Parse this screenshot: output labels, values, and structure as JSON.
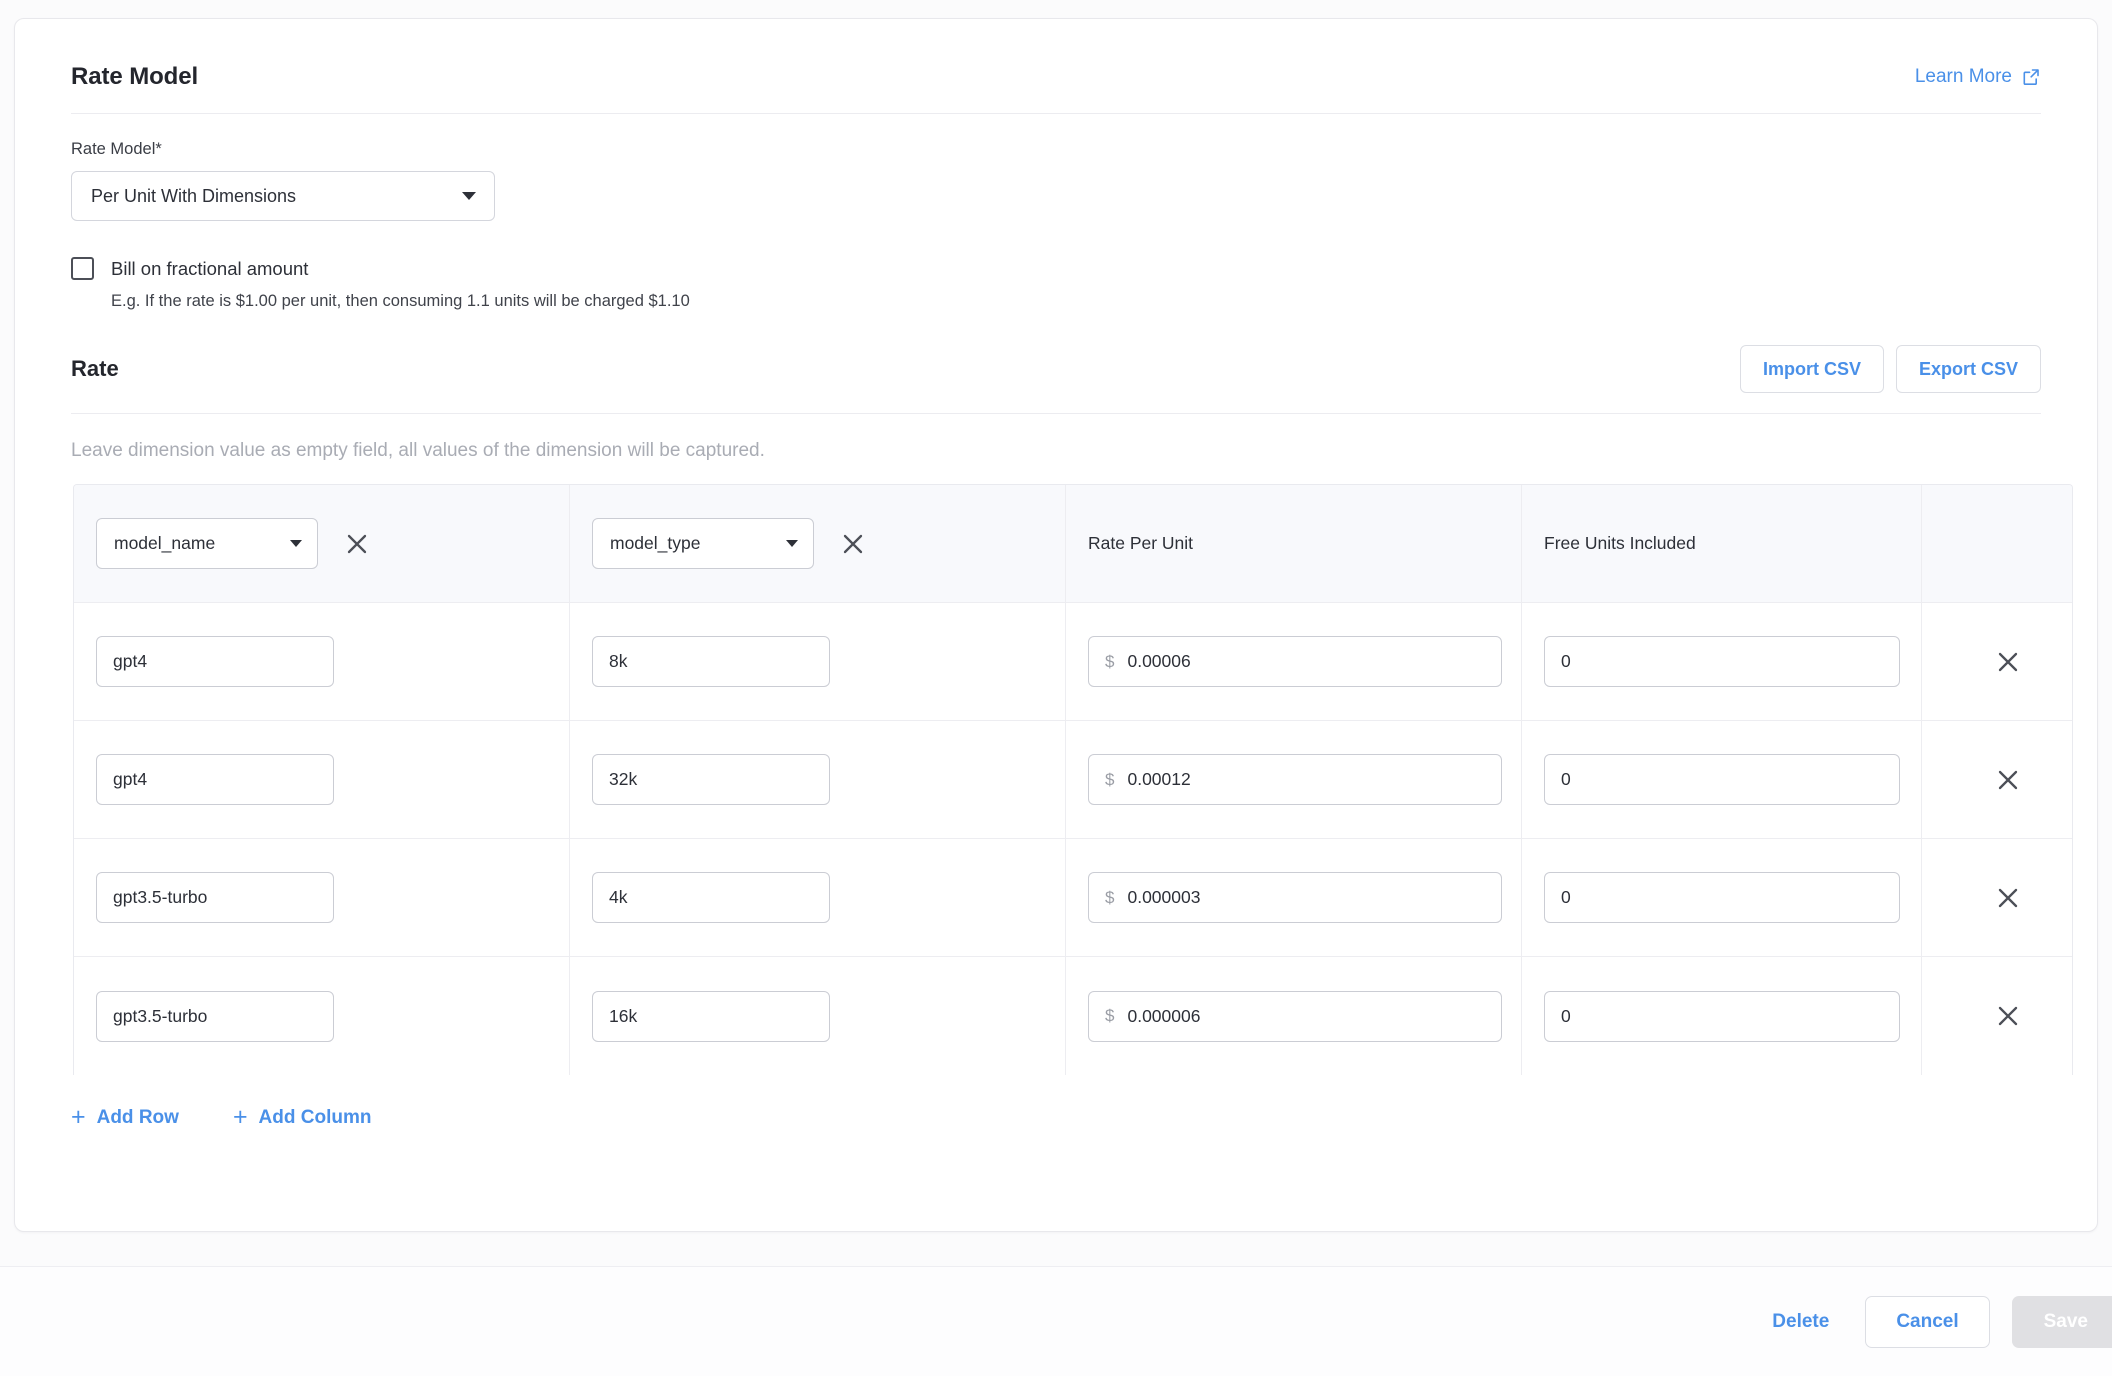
{
  "section": {
    "title": "Rate Model",
    "learn_more": "Learn More",
    "learn_more_icon": "external-link-icon"
  },
  "rate_model_field": {
    "label": "Rate Model*",
    "value": "Per Unit With Dimensions",
    "caret_icon": "chevron-down-icon"
  },
  "fractional": {
    "label": "Bill on fractional amount",
    "checked": false,
    "help": "E.g. If the rate is $1.00 per unit, then consuming 1.1 units will be charged $1.10"
  },
  "rate_section": {
    "title": "Rate",
    "import_csv": "Import CSV",
    "export_csv": "Export CSV",
    "hint": "Leave dimension value as empty field, all values of the dimension will be captured."
  },
  "table": {
    "dimension_columns": [
      {
        "value": "model_name",
        "remove_icon": "close-icon"
      },
      {
        "value": "model_type",
        "remove_icon": "close-icon"
      }
    ],
    "static_columns": [
      "Rate Per Unit",
      "Free Units Included"
    ],
    "currency_symbol": "$",
    "rows": [
      {
        "model_name": "gpt4",
        "model_type": "8k",
        "rate_per_unit": "0.00006",
        "free_units": "0",
        "remove_icon": "close-icon"
      },
      {
        "model_name": "gpt4",
        "model_type": "32k",
        "rate_per_unit": "0.00012",
        "free_units": "0",
        "remove_icon": "close-icon"
      },
      {
        "model_name": "gpt3.5-turbo",
        "model_type": "4k",
        "rate_per_unit": "0.000003",
        "free_units": "0",
        "remove_icon": "close-icon"
      },
      {
        "model_name": "gpt3.5-turbo",
        "model_type": "16k",
        "rate_per_unit": "0.000006",
        "free_units": "0",
        "remove_icon": "close-icon"
      }
    ]
  },
  "actions": {
    "add_row": "Add Row",
    "add_column": "Add Column",
    "plus_icon": "plus-icon"
  },
  "footer": {
    "delete": "Delete",
    "cancel": "Cancel",
    "save": "Save",
    "save_disabled": true
  },
  "colors": {
    "accent": "#4a90e8",
    "text": "#2d3038",
    "muted": "#a9acb4",
    "header_bg": "#f8f9fc",
    "border": "#ededf1",
    "save_disabled_bg": "#e0e0e3"
  }
}
